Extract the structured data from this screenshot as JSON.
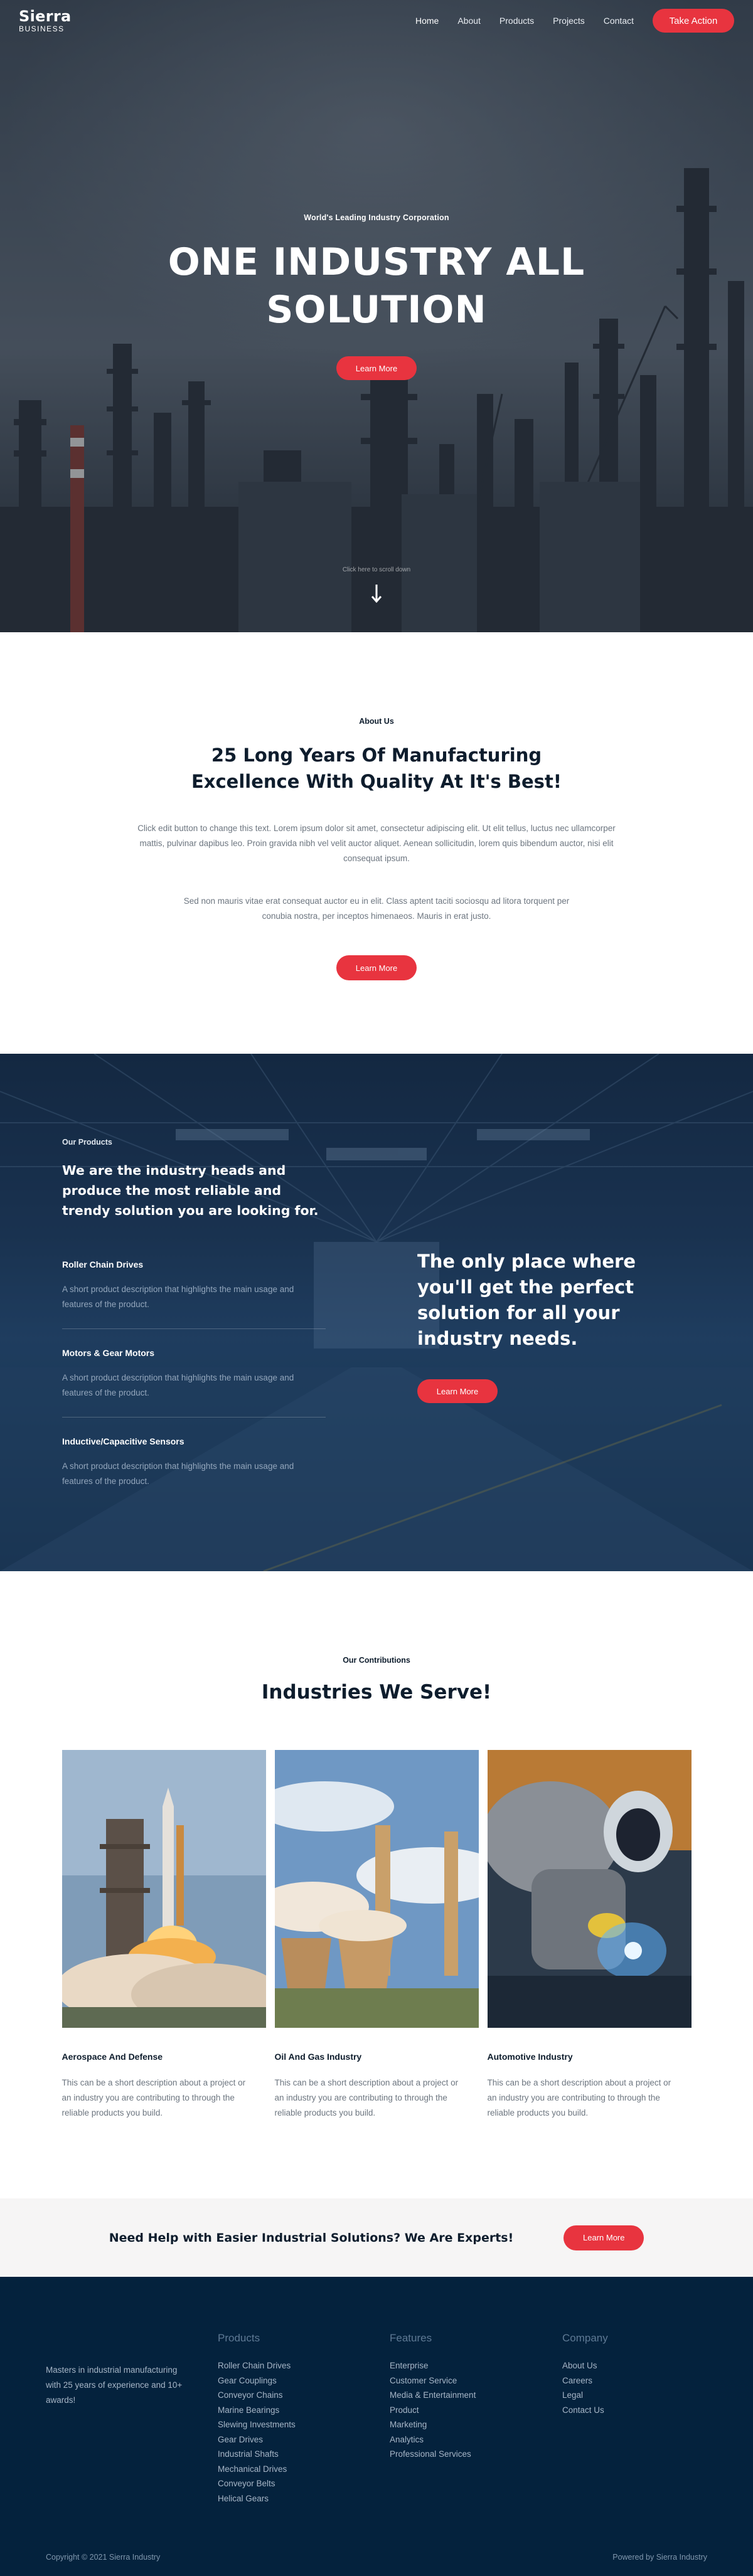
{
  "brand": {
    "name": "Sierra",
    "tagline": "BUSINESS"
  },
  "nav": {
    "items": [
      {
        "label": "Home"
      },
      {
        "label": "About"
      },
      {
        "label": "Products"
      },
      {
        "label": "Projects"
      },
      {
        "label": "Contact"
      }
    ],
    "cta_label": "Take Action"
  },
  "hero": {
    "eyebrow": "World's Leading Industry Corporation",
    "title": "ONE INDUSTRY ALL SOLUTION",
    "button_label": "Learn More",
    "scroll_note": "Click here to scroll down"
  },
  "about": {
    "eyebrow": "About Us",
    "title": "25 Long Years Of Manufacturing Excellence With Quality At It's Best!",
    "paragraph1": "Click edit button to change this text. Lorem ipsum dolor sit amet, consectetur adipiscing elit. Ut elit tellus, luctus nec ullamcorper mattis, pulvinar dapibus leo. Proin gravida nibh vel velit auctor aliquet. Aenean sollicitudin, lorem quis bibendum auctor, nisi elit consequat ipsum.",
    "paragraph2": "Sed non mauris vitae erat consequat auctor eu in elit. Class aptent taciti sociosqu ad litora torquent per conubia nostra, per inceptos himenaeos. Mauris in erat justo.",
    "button_label": "Learn More"
  },
  "products": {
    "eyebrow": "Our Products",
    "title": "We are the industry heads and produce the most reliable and trendy solution you are looking for.",
    "items": [
      {
        "name": "Roller Chain Drives",
        "description": "A short product description that highlights the main usage and features of the product."
      },
      {
        "name": "Motors & Gear Motors",
        "description": "A short product description that highlights the main usage and features of the product."
      },
      {
        "name": "Inductive/Capacitive Sensors",
        "description": "A short product description that highlights the main usage and features of the product."
      }
    ],
    "side_title": "The only place where you'll get the perfect solution for all your industry needs.",
    "side_button_label": "Learn More"
  },
  "industries": {
    "eyebrow": "Our Contributions",
    "title": "Industries We Serve!",
    "cards": [
      {
        "title": "Aerospace And Defense",
        "description": "This can be a short description about a project or an industry you are contributing to through the reliable products you build.",
        "image_icon": "rocket-launch-image"
      },
      {
        "title": "Oil And Gas Industry",
        "description": "This can be a short description about a project or an industry you are contributing to through the reliable products you build.",
        "image_icon": "power-plant-image"
      },
      {
        "title": "Automotive Industry",
        "description": "This can be a short description about a project or an industry you are contributing to through the reliable products you build.",
        "image_icon": "welder-image"
      }
    ]
  },
  "cta_banner": {
    "text": "Need Help with Easier Industrial Solutions? We Are Experts!",
    "button_label": "Learn More"
  },
  "footer": {
    "about_text": "Masters in industrial manufacturing with 25 years of experience and 10+ awards!",
    "columns": [
      {
        "heading": "Products",
        "links": [
          "Roller Chain Drives",
          "Gear Couplings",
          "Conveyor Chains",
          "Marine Bearings",
          "Slewing Investments",
          "Gear Drives",
          "Industrial Shafts",
          "Mechanical Drives",
          "Conveyor Belts",
          "Helical Gears"
        ]
      },
      {
        "heading": "Features",
        "links": [
          "Enterprise",
          "Customer Service",
          "Media & Entertainment",
          "Product",
          "Marketing",
          "Analytics",
          "Professional Services"
        ]
      },
      {
        "heading": "Company",
        "links": [
          "About Us",
          "Careers",
          "Legal",
          "Contact Us"
        ]
      }
    ],
    "copyright": "Copyright © 2021 Sierra Industry",
    "powered_by": "Powered by Sierra Industry"
  },
  "colors": {
    "accent": "#e8343f",
    "navy": "#04223d",
    "heading": "#0e1d2d",
    "muted_text": "#6d7680",
    "cta_background": "#f6f5f5"
  }
}
